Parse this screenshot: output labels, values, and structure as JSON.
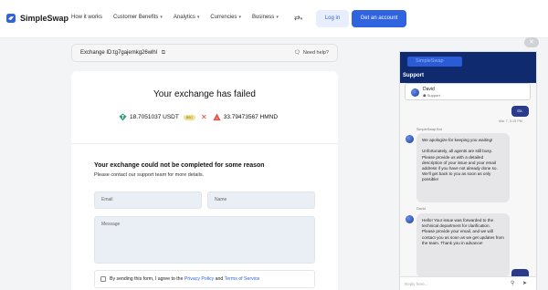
{
  "header": {
    "logo_text": "SimpleSwap",
    "nav": [
      {
        "label": "How it works",
        "dropdown": false
      },
      {
        "label": "Customer Benefits",
        "dropdown": true
      },
      {
        "label": "Analytics",
        "dropdown": true
      },
      {
        "label": "Currencies",
        "dropdown": true
      },
      {
        "label": "Business",
        "dropdown": true
      }
    ],
    "login_label": "Log in",
    "get_account_label": "Get an account",
    "accent": "#2f63e0"
  },
  "exchange": {
    "id_label": "Exchange ID:tg7gajemkg26wlhl",
    "need_help": "Need help?",
    "status_title": "Your exchange has failed",
    "from_amount": "18.7051037 USDT",
    "from_network": "BSC",
    "to_amount": "33.79473567 HMND",
    "error_title": "Your exchange could not be completed for some reason",
    "error_sub": "Please contact our support team for more details.",
    "email_placeholder": "Email",
    "name_placeholder": "Name",
    "message_placeholder": "Message",
    "consent_prefix": "By sending this form, I agree to the",
    "privacy_link": "Privacy Policy",
    "consent_and": "and",
    "terms_link": "Terms of Service"
  },
  "chat": {
    "brand": "SimpleSwap",
    "title": "Support",
    "agent_name": "David",
    "agent_role": "Support",
    "user_message": "trx.",
    "user_timestamp": "Mar 7, 3:15 PM",
    "messages": [
      {
        "sender": "SimpleSwap Bot",
        "text": "We apologize for keeping you waiting!\n\nUnfortunately, all agents are still busy. Please provide us with a detailed description of your issue and your email address if you have not already done so. We'll get back to you as soon as only possible!"
      },
      {
        "sender": "David",
        "text": "Hello! Your issue was forwarded to the technical department for clarification. Please provide your email, and we will contact you as soon as we get updates from the team. Thank you in advance!"
      }
    ],
    "reply_placeholder": "Reply here...",
    "header_color": "#0f2a6e"
  }
}
